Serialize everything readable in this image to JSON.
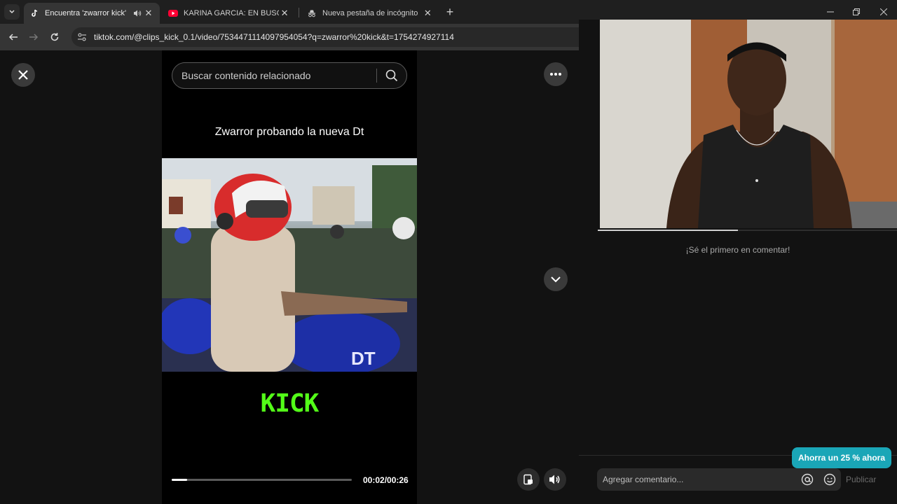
{
  "browser": {
    "tabs": [
      {
        "title": "Encuentra 'zwarror kick' en",
        "icon": "tiktok-icon",
        "active": true,
        "audio": true
      },
      {
        "title": "KARINA GARCIA: EN BUSCA DE",
        "icon": "youtube-icon",
        "active": false,
        "audio": false
      },
      {
        "title": "Nueva pestaña de incógnito",
        "icon": "incognito-icon",
        "active": false,
        "audio": false
      }
    ],
    "url": "tiktok.com/@clips_kick_0.1/video/7534471114097954054?q=zwarror%20kick&t=1754274927114"
  },
  "tiktok": {
    "search_placeholder": "Buscar contenido relacionado",
    "video_title": "Zwarror probando la nueva Dt",
    "brand_text": "KICK",
    "brand_color": "#53fc18",
    "time_display": "00:02/00:26",
    "progress_fraction": 0.085
  },
  "comments": {
    "empty_text": "¡Sé el primero en comentar!",
    "promo_text": "Ahorra un 25 % ahora",
    "input_placeholder": "Agregar comentario...",
    "publish_label": "Publicar"
  },
  "colors": {
    "accent_teal": "#1aa6b7",
    "background": "#121212"
  }
}
